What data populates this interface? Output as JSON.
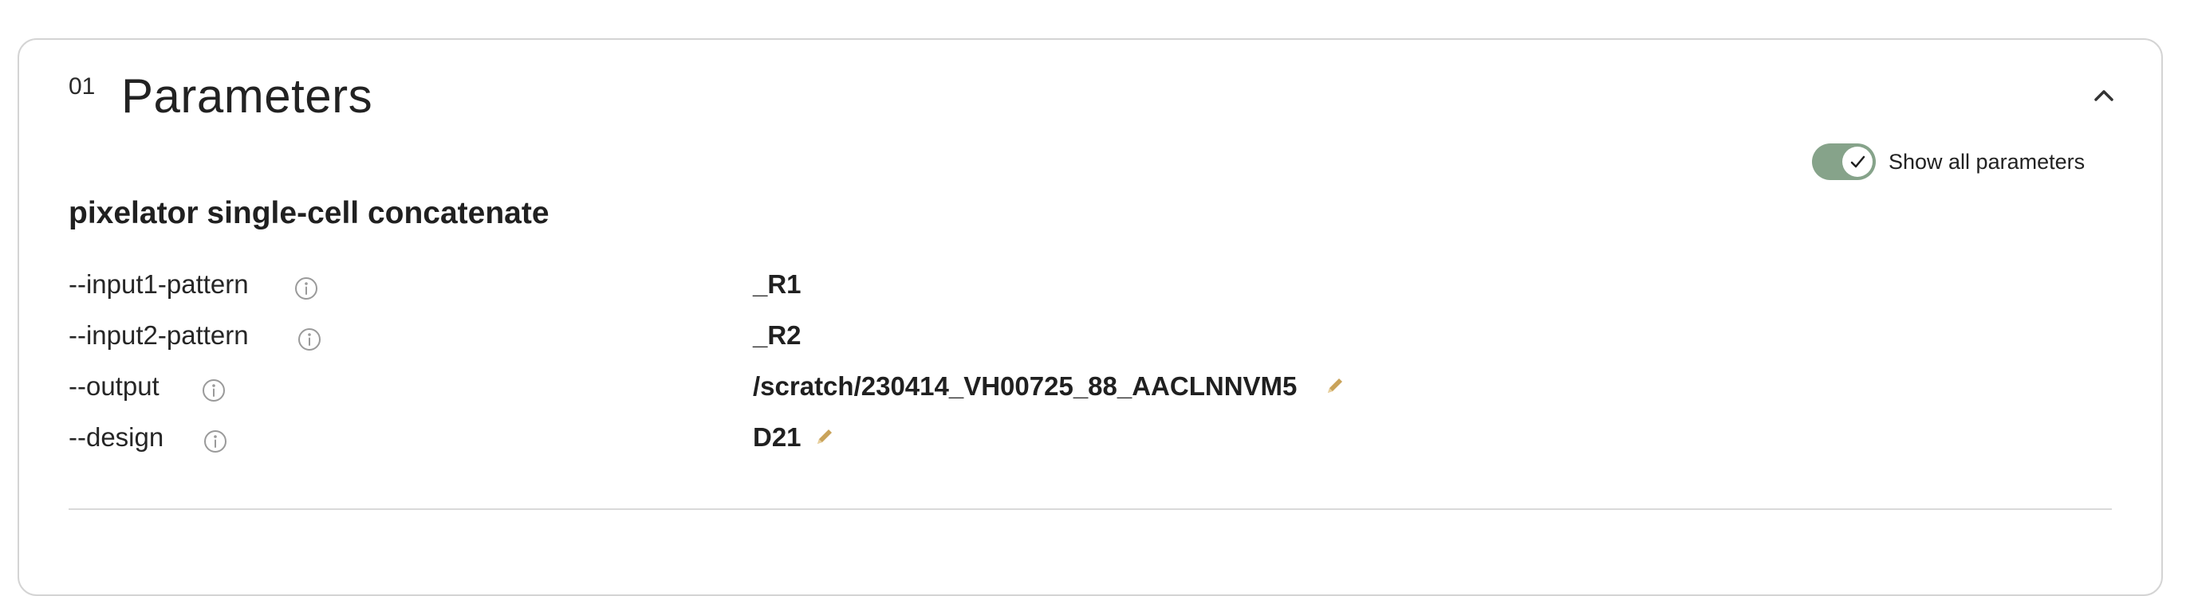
{
  "section": {
    "index": "01",
    "title": "Parameters"
  },
  "toggle": {
    "label": "Show all parameters",
    "checked": true,
    "color": "#86a38a"
  },
  "tool": {
    "name": "pixelator single-cell concatenate"
  },
  "params": [
    {
      "name": "--input1-pattern",
      "value": "_R1",
      "editable": false
    },
    {
      "name": "--input2-pattern",
      "value": "_R2",
      "editable": false
    },
    {
      "name": "--output",
      "value": "/scratch/230414_VH00725_88_AACLNNVM5",
      "editable": true
    },
    {
      "name": "--design",
      "value": "D21",
      "editable": true
    }
  ],
  "icons": {
    "collapse": "chevron-up-icon",
    "info": "info-icon",
    "edit": "pencil-icon",
    "check": "check-icon"
  },
  "colors": {
    "edit_icon": "#c9a35a",
    "info_icon": "#9a9a9a"
  }
}
